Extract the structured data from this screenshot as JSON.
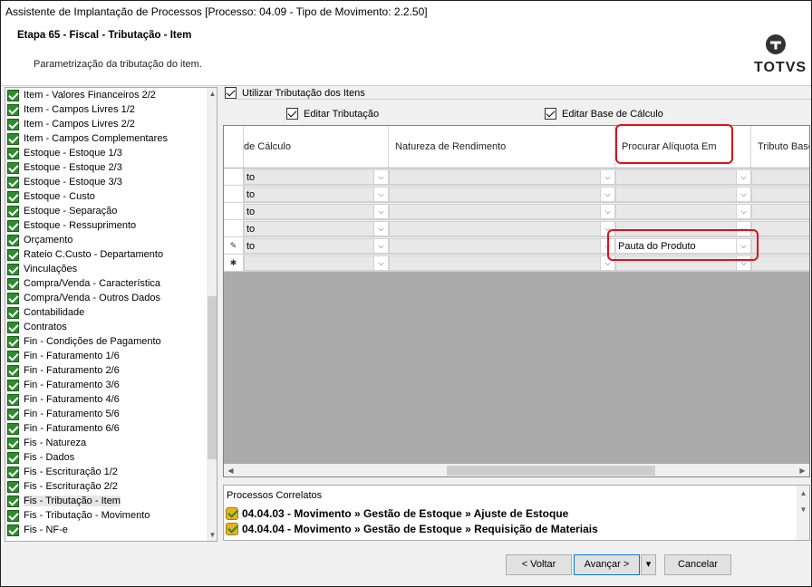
{
  "window": {
    "title": "Assistente de Implantação de Processos [Processo: 04.09 - Tipo de Movimento: 2.2.50]"
  },
  "header": {
    "step_title": "Etapa 65 - Fiscal - Tributação - Item",
    "step_subtitle": "Parametrização da tributação do item.",
    "logo_text": "TOTVS"
  },
  "tree": {
    "items": [
      {
        "label": "Item - Valores Financeiros 2/2"
      },
      {
        "label": "Item - Campos Livres 1/2"
      },
      {
        "label": "Item - Campos Livres 2/2"
      },
      {
        "label": "Item - Campos Complementares"
      },
      {
        "label": "Estoque - Estoque 1/3"
      },
      {
        "label": "Estoque - Estoque 2/3"
      },
      {
        "label": "Estoque - Estoque 3/3"
      },
      {
        "label": "Estoque - Custo"
      },
      {
        "label": "Estoque - Separação"
      },
      {
        "label": "Estoque - Ressuprimento"
      },
      {
        "label": "Orçamento"
      },
      {
        "label": "Rateio C.Custo - Departamento"
      },
      {
        "label": "Vinculações"
      },
      {
        "label": "Compra/Venda - Característica"
      },
      {
        "label": "Compra/Venda - Outros Dados"
      },
      {
        "label": "Contabilidade"
      },
      {
        "label": "Contratos"
      },
      {
        "label": "Fin - Condições de Pagamento"
      },
      {
        "label": "Fin - Faturamento 1/6"
      },
      {
        "label": "Fin - Faturamento 2/6"
      },
      {
        "label": "Fin - Faturamento 3/6"
      },
      {
        "label": "Fin - Faturamento 4/6"
      },
      {
        "label": "Fin - Faturamento 5/6"
      },
      {
        "label": "Fin - Faturamento 6/6"
      },
      {
        "label": "Fis - Natureza"
      },
      {
        "label": "Fis - Dados"
      },
      {
        "label": "Fis - Escrituração 1/2"
      },
      {
        "label": "Fis - Escrituração 2/2"
      },
      {
        "label": "Fis - Tributação - Item",
        "selected": true
      },
      {
        "label": "Fis - Tributação - Movimento"
      },
      {
        "label": "Fis - NF-e"
      }
    ]
  },
  "options": {
    "use_item_taxation": "Utilizar Tributação dos Itens",
    "edit_taxation": "Editar Tributação",
    "edit_calc_base": "Editar Base de Cálculo"
  },
  "grid": {
    "columns": [
      "de Cálculo",
      "Natureza de Rendimento",
      "Procurar Alíquota Em",
      "Tributo Base"
    ],
    "rows": [
      {
        "marker": "",
        "col1": "to",
        "col3": ""
      },
      {
        "marker": "",
        "col1": "to",
        "col3": ""
      },
      {
        "marker": "",
        "col1": "to",
        "col3": ""
      },
      {
        "marker": "",
        "col1": "to",
        "col3": ""
      },
      {
        "marker": "✎",
        "col1": "to",
        "col3": "Pauta do Produto"
      },
      {
        "marker": "✱",
        "col1": "",
        "col3": ""
      }
    ]
  },
  "related": {
    "title": "Processos Correlatos",
    "items": [
      {
        "label": "04.04.03 - Movimento » Gestão de Estoque » Ajuste de Estoque"
      },
      {
        "label": "04.04.04 - Movimento » Gestão de Estoque » Requisição de Materiais"
      }
    ]
  },
  "buttons": {
    "back": "< Voltar",
    "next": "Avançar >",
    "next_menu": "▾",
    "cancel": "Cancelar"
  },
  "colors": {
    "highlight_box": "#e0101a",
    "check_green": "#2e8b2e"
  }
}
